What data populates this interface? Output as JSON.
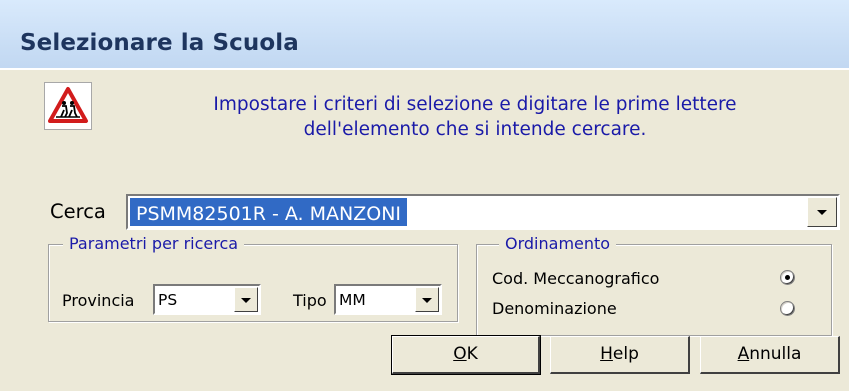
{
  "window": {
    "title": "Selezionare la Scuola"
  },
  "instruction": {
    "line1": "Impostare i criteri di selezione e digitare le prime lettere",
    "line2": "dell'elemento che si intende cercare."
  },
  "search": {
    "label": "Cerca",
    "value": "PSMM82501R - A. MANZONI"
  },
  "parametri": {
    "title": "Parametri per ricerca",
    "provincia_label": "Provincia",
    "provincia_value": "PS",
    "tipo_label": "Tipo",
    "tipo_value": "MM"
  },
  "ordinamento": {
    "title": "Ordinamento",
    "options": [
      {
        "label": "Cod. Meccanografico",
        "selected": true
      },
      {
        "label": "Denominazione",
        "selected": false
      }
    ]
  },
  "buttons": {
    "ok_accel": "O",
    "ok_rest": "K",
    "help_accel": "H",
    "help_rest": "elp",
    "annulla_accel": "A",
    "annulla_rest": "nnulla"
  },
  "icons": {
    "warning": "children-crossing-warning-icon",
    "dropdown": "chevron-down-icon"
  },
  "colors": {
    "instruction_text": "#1a1aa8",
    "selection": "#316ac5",
    "dialog_bg": "#ece9d8"
  }
}
